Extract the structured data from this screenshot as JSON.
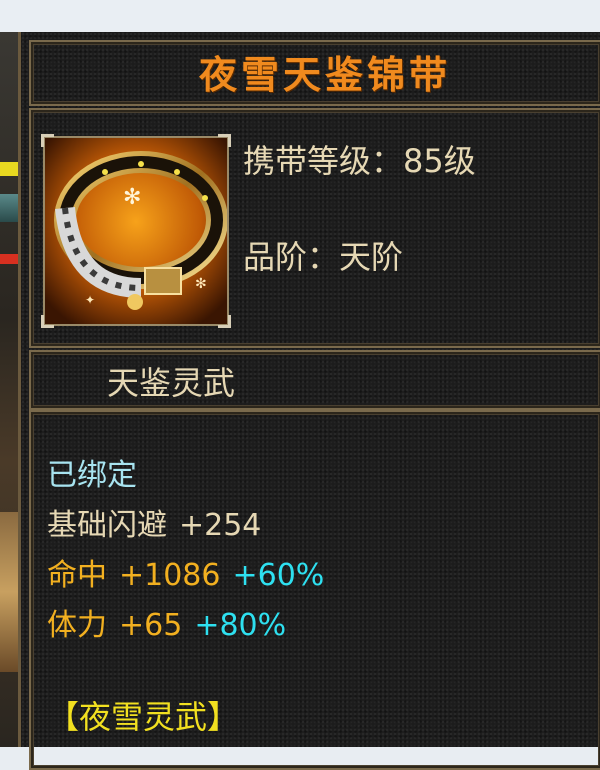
{
  "item": {
    "name": "夜雪天鉴锦带",
    "carry_level": "携带等级：85级",
    "grade": "品阶：天阶",
    "series": "天鉴灵武"
  },
  "stats": {
    "bound": "已绑定",
    "dodge": {
      "label": "基础闪避",
      "value": "+254"
    },
    "hit": {
      "label": "命中",
      "value": "+1086",
      "bonus": "+60%"
    },
    "stamina": {
      "label": "体力",
      "value": "+65",
      "bonus": "+80%"
    },
    "set_name": "【夜雪灵武】"
  },
  "icons": {
    "item_icon": "jeweled-belt-icon"
  },
  "colors": {
    "title": "#f08a1e",
    "info": "#e6d8b4",
    "bound": "#a8e4f0",
    "dodge": "#e6d8b4",
    "hit": "#f2b020",
    "bonus": "#2ee0f0",
    "stamina": "#f2b020",
    "set": "#f2e020"
  }
}
